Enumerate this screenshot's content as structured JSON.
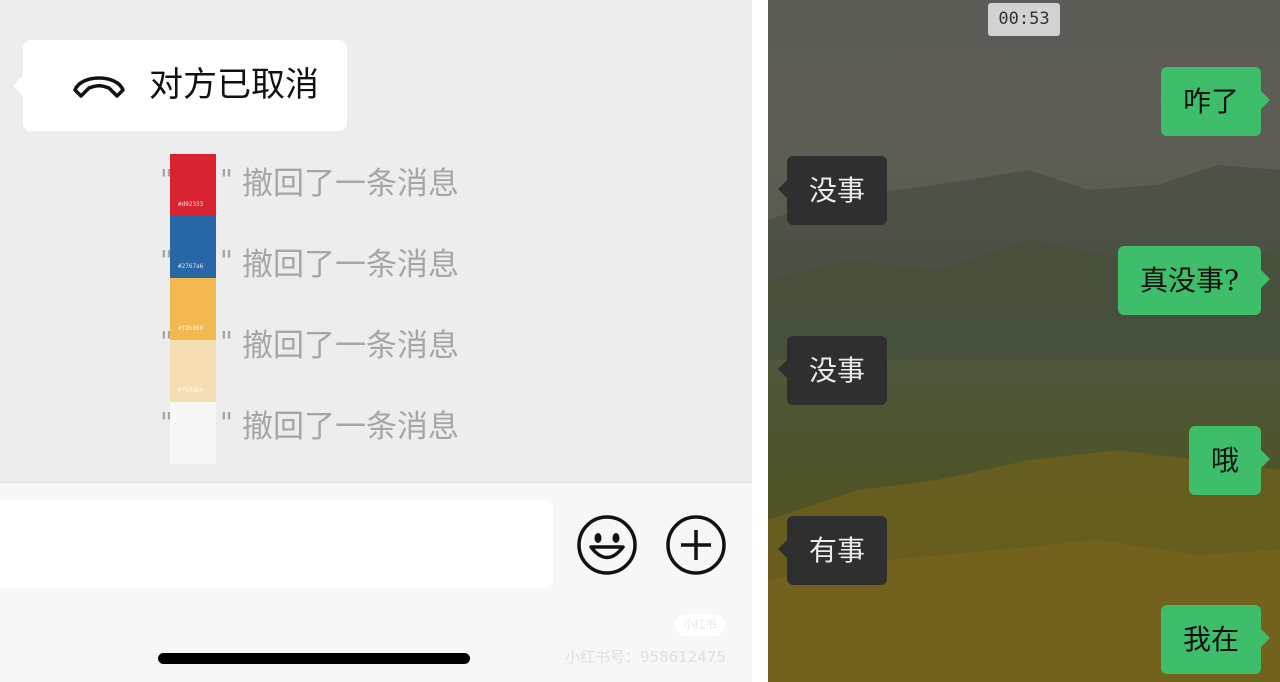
{
  "left": {
    "call_status": "对方已取消",
    "recalled_rows": [
      {
        "open_quote": "\"",
        "close_quote": "\"",
        "text": "撤回了一条消息"
      },
      {
        "open_quote": "\"",
        "close_quote": "\"",
        "text": "撤回了一条消息"
      },
      {
        "open_quote": "\"",
        "close_quote": "\"",
        "text": "撤回了一条消息"
      },
      {
        "open_quote": "\"",
        "close_quote": "\"",
        "text": "撤回了一条消息"
      }
    ],
    "swatches": [
      {
        "color": "#d92333",
        "label": "#d92333"
      },
      {
        "color": "#2767a6",
        "label": "#2767a6"
      },
      {
        "color": "#f2b950",
        "label": "#f2b950"
      },
      {
        "color": "#f5ddb4",
        "label": "#f5ddb4"
      },
      {
        "color": "#f7f7f7",
        "label": ""
      }
    ],
    "input_value": "",
    "watermark_badge": "小红书",
    "watermark_id": "小红书号：958612475"
  },
  "right": {
    "time": "00:53",
    "messages": [
      {
        "side": "sent",
        "text": "咋了"
      },
      {
        "side": "received",
        "text": "没事"
      },
      {
        "side": "sent",
        "text": "真没事?"
      },
      {
        "side": "received",
        "text": "没事"
      },
      {
        "side": "sent",
        "text": "哦"
      },
      {
        "side": "received",
        "text": "有事"
      },
      {
        "side": "sent",
        "text": "我在"
      }
    ]
  },
  "icons": {
    "phone": "hang-up-phone-icon",
    "emoji": "smiley-face-icon",
    "plus": "plus-circle-icon"
  },
  "colors": {
    "sent_bubble": "#3ebd6b",
    "received_bubble": "#2f2f2f",
    "recall_text": "#a6a6a6"
  }
}
